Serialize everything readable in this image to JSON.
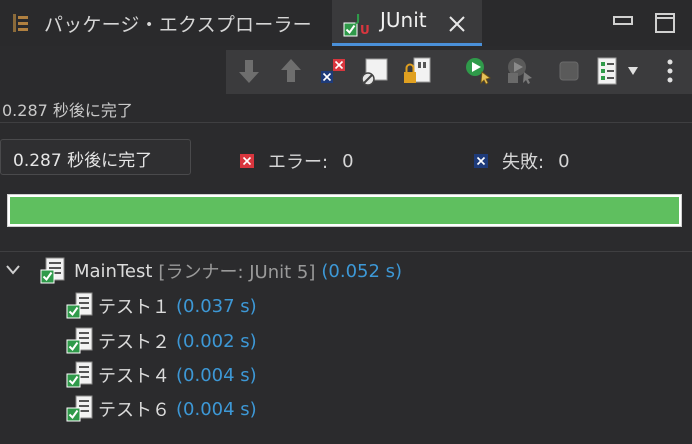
{
  "tabs": {
    "package_explorer": "パッケージ・エクスプローラー",
    "junit": "JUnit"
  },
  "status": {
    "finished_line": "0.287 秒後に完了",
    "tooltip": "0.287 秒後に完了"
  },
  "counters": {
    "errors_label": "エラー:",
    "errors_value": "0",
    "failures_label": "失敗:",
    "failures_value": "0"
  },
  "progress": {
    "fraction": 1.0,
    "color": "#5fbf5f"
  },
  "tree": {
    "root": {
      "name": "MainTest",
      "meta": "[ランナー: JUnit 5]",
      "time": "(0.052 s)"
    },
    "children": [
      {
        "name": "テスト１",
        "time": "(0.037 s)"
      },
      {
        "name": "テスト２",
        "time": "(0.002 s)"
      },
      {
        "name": "テスト４",
        "time": "(0.004 s)"
      },
      {
        "name": "テスト６",
        "time": "(0.004 s)"
      }
    ]
  },
  "colors": {
    "accent": "#4a90d9",
    "success": "#5fbf5f",
    "time": "#3d98d6",
    "error": "#d9363e"
  },
  "icons": [
    "package-explorer-icon",
    "junit-icon",
    "close-icon",
    "minimize-icon",
    "maximize-icon",
    "next-failure-icon",
    "previous-failure-icon",
    "show-failures-only-icon",
    "show-skipped-icon",
    "scroll-lock-icon",
    "rerun-icon",
    "rerun-failures-first-icon",
    "stop-icon",
    "history-icon",
    "view-menu-icon"
  ]
}
